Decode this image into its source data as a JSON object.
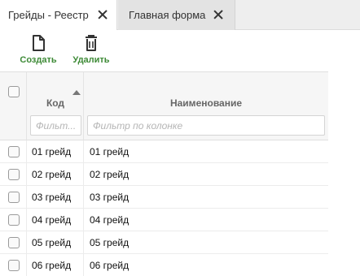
{
  "tabs": [
    {
      "label": "Грейды - Реестр",
      "active": true
    },
    {
      "label": "Главная форма",
      "active": false
    }
  ],
  "toolbar": {
    "create_label": "Создать",
    "delete_label": "Удалить",
    "create_icon": "file-icon",
    "delete_icon": "trash-icon",
    "accent": "#3d8a36"
  },
  "grid": {
    "columns": [
      {
        "key": "code",
        "label": "Код",
        "filter_placeholder": "Фильт...",
        "sort": "asc"
      },
      {
        "key": "name",
        "label": "Наименование",
        "filter_placeholder": "Фильтр по колонке"
      }
    ],
    "rows": [
      {
        "code": "01 грейд",
        "name": "01 грейд"
      },
      {
        "code": "02 грейд",
        "name": "02 грейд"
      },
      {
        "code": "03 грейд",
        "name": "03 грейд"
      },
      {
        "code": "04 грейд",
        "name": "04 грейд"
      },
      {
        "code": "05 грейд",
        "name": "05 грейд"
      },
      {
        "code": "06 грейд",
        "name": "06 грейд"
      }
    ]
  }
}
